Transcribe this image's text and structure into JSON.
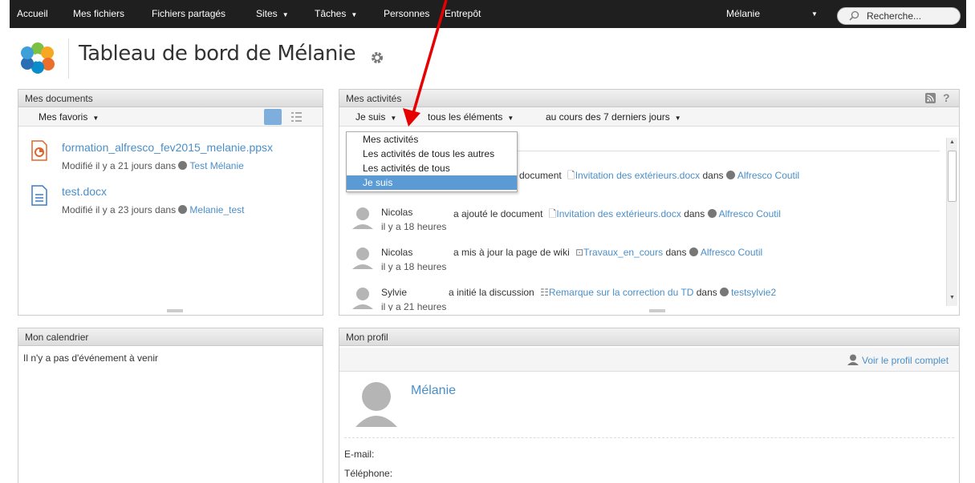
{
  "nav": {
    "items": [
      {
        "label": "Accueil",
        "caret": false
      },
      {
        "label": "Mes fichiers",
        "caret": false
      },
      {
        "label": "Fichiers partagés",
        "caret": false
      },
      {
        "label": "Sites",
        "caret": true
      },
      {
        "label": "Tâches",
        "caret": true
      },
      {
        "label": "Personnes",
        "caret": false
      },
      {
        "label": "Entrepôt",
        "caret": false
      }
    ],
    "user": "Mélanie",
    "search_placeholder": "Recherche..."
  },
  "header": {
    "title": "Tableau de bord de Mélanie"
  },
  "docs": {
    "title": "Mes documents",
    "filter": "Mes favoris",
    "items": [
      {
        "name": "formation_alfresco_fev2015_melanie.ppsx",
        "meta": "Modifié il y a 21 jours dans",
        "site": "Test Mélanie",
        "type": "ppsx"
      },
      {
        "name": "test.docx",
        "meta": "Modifié il y a 23 jours dans",
        "site": "Melanie_test",
        "type": "docx"
      }
    ]
  },
  "activities": {
    "title": "Mes activités",
    "filter_who": "Je suis",
    "filter_what": "tous les éléments",
    "filter_when": "au cours des 7 derniers jours",
    "dropdown": [
      "Mes activités",
      "Les activités de tous les autres",
      "Les activités de tous",
      "Je suis"
    ],
    "dropdown_selected": 3,
    "partial_line": {
      "action": "document",
      "doc": "Invitation des extérieurs.docx",
      "in": "dans",
      "site": "Alfresco Coutil"
    },
    "items": [
      {
        "user": "Nicolas",
        "action": "a ajouté le document",
        "doc": "Invitation des extérieurs.docx",
        "in": "dans",
        "site": "Alfresco Coutil",
        "time": "il y a 18 heures"
      },
      {
        "user": "Nicolas",
        "action": "a mis à jour la page de wiki",
        "doc": "Travaux_en_cours",
        "in": "dans",
        "site": "Alfresco Coutil",
        "time": "il y a 18 heures"
      },
      {
        "user": "Sylvie",
        "action": "a initié la discussion",
        "doc": "Remarque sur la correction du TD",
        "in": "dans",
        "site": "testsylvie2",
        "time": "il y a 21 heures"
      }
    ]
  },
  "calendar": {
    "title": "Mon calendrier",
    "empty": "Il n'y a pas d'événement à venir"
  },
  "profile": {
    "title": "Mon profil",
    "full_profile_link": "Voir le profil complet",
    "name": "Mélanie",
    "email_label": "E-mail:",
    "phone_label": "Téléphone:"
  },
  "colors": {
    "link": "#4a8fc9",
    "topbar": "#1f1f1f",
    "selected": "#5a9ad5",
    "arrow": "#e60000"
  }
}
